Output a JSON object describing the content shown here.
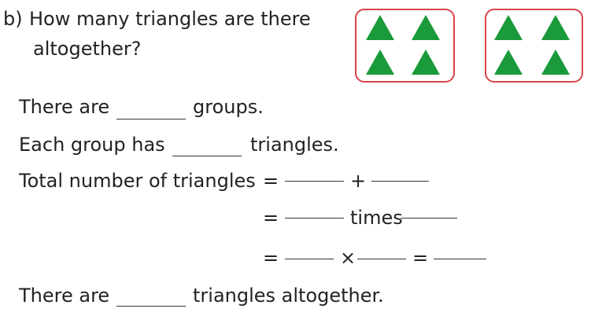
{
  "question": {
    "label": "b)",
    "line1": "How many triangles are there",
    "line2": "altogether?"
  },
  "groups": {
    "count": 2,
    "triangles_per_group": 4,
    "triangle_color": "#1a9a3a",
    "border_color": "#d9434a"
  },
  "sentences": {
    "groups_prefix": "There are",
    "groups_suffix": "groups.",
    "each_prefix": "Each group has",
    "each_suffix": "triangles.",
    "total_prefix": "Total number of triangles",
    "equals": "=",
    "plus": "+",
    "times_word": "times",
    "times_sign": "×",
    "final_prefix": "There are",
    "final_suffix": "triangles altogether."
  }
}
